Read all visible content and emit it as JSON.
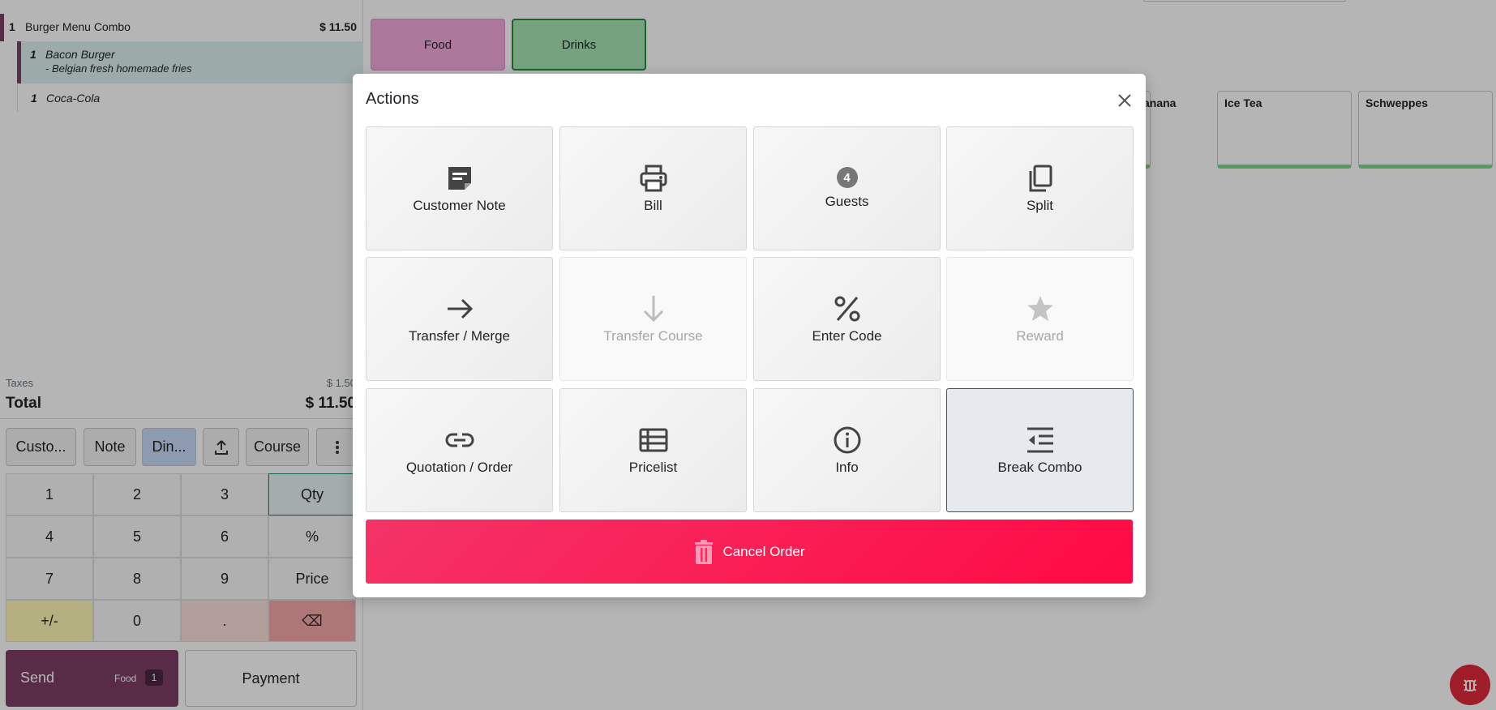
{
  "order": {
    "lines": [
      {
        "qty": "1",
        "name": "Burger Menu Combo",
        "price": "$ 11.50"
      },
      {
        "qty": "1",
        "name": "Bacon Burger",
        "note": "- Belgian fresh homemade fries"
      },
      {
        "qty": "1",
        "name": "Coca-Cola"
      }
    ],
    "taxes_label": "Taxes",
    "taxes_value": "$ 1.50",
    "total_label": "Total",
    "total_value": "$ 11.50"
  },
  "controls": {
    "customer": "Custo...",
    "note": "Note",
    "dine": "Din...",
    "course": "Course"
  },
  "numpad": {
    "keys": [
      "1",
      "2",
      "3",
      "Qty",
      "4",
      "5",
      "6",
      "%",
      "7",
      "8",
      "9",
      "Price",
      "+/-",
      "0",
      ".",
      "⌫"
    ]
  },
  "send": {
    "label": "Send",
    "category": "Food",
    "count": "1"
  },
  "payment": {
    "label": "Payment"
  },
  "categories": {
    "food": "Food",
    "drinks": "Drinks"
  },
  "products": [
    "anana",
    "Ice Tea",
    "Schweppes"
  ],
  "modal": {
    "title": "Actions",
    "actions": [
      {
        "label": "Customer Note",
        "icon": "note-icon"
      },
      {
        "label": "Bill",
        "icon": "printer-icon"
      },
      {
        "label": "Guests",
        "icon": "guests-badge",
        "badge": "4"
      },
      {
        "label": "Split",
        "icon": "copy-icon"
      },
      {
        "label": "Transfer / Merge",
        "icon": "arrow-right-icon"
      },
      {
        "label": "Transfer Course",
        "icon": "arrow-down-icon",
        "disabled": true
      },
      {
        "label": "Enter Code",
        "icon": "percent-icon"
      },
      {
        "label": "Reward",
        "icon": "star-icon",
        "disabled": true
      },
      {
        "label": "Quotation / Order",
        "icon": "link-icon"
      },
      {
        "label": "Pricelist",
        "icon": "list-icon"
      },
      {
        "label": "Info",
        "icon": "info-icon"
      },
      {
        "label": "Break Combo",
        "icon": "indent-icon",
        "selected": true
      }
    ],
    "cancel_label": "Cancel Order"
  },
  "colors": {
    "accent": "#7c3e64",
    "cancel": "#ff1a52",
    "drinks": "#a7e4b5",
    "food": "#f2a9dc"
  }
}
